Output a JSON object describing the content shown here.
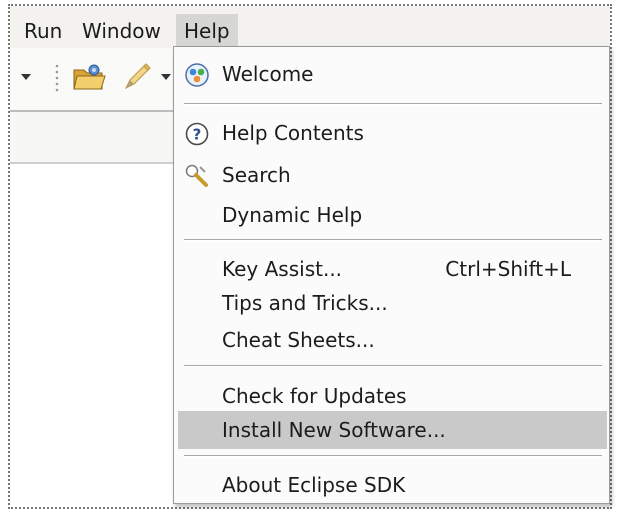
{
  "menubar": {
    "run": "Run",
    "window": "Window",
    "help": "Help"
  },
  "colors": {
    "menu_highlight": "#d6d6d2",
    "item_highlight": "#c9c9c9",
    "separator": "#a8a8a8"
  },
  "toolbar": {
    "icons": [
      "dropdown-arrow-icon",
      "open-folder-icon",
      "pencil-tool-icon"
    ]
  },
  "help_menu": {
    "welcome": "Welcome",
    "help_contents": "Help Contents",
    "search": "Search",
    "dynamic_help": "Dynamic Help",
    "key_assist": "Key Assist...",
    "key_assist_shortcut": "Ctrl+Shift+L",
    "tips_and_tricks": "Tips and Tricks...",
    "cheat_sheets": "Cheat Sheets...",
    "check_for_updates": "Check for Updates",
    "install_new_software": "Install New Software...",
    "about": "About Eclipse SDK",
    "highlighted_item": "install_new_software"
  }
}
